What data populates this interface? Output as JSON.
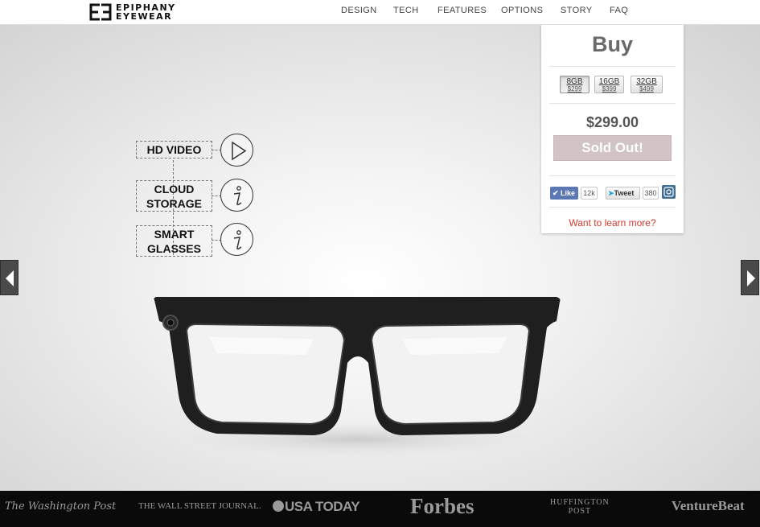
{
  "brand": {
    "line1": "EPIPHANY",
    "line2": "EYEWEAR",
    "logo_icon": "ee-logo-mark"
  },
  "nav": {
    "items": [
      "DESIGN",
      "TECH",
      "FEATURES",
      "OPTIONS",
      "STORY",
      "FAQ"
    ]
  },
  "features": [
    {
      "lines": [
        "HD VIDEO"
      ],
      "icon": "play-icon"
    },
    {
      "lines": [
        "CLOUD",
        "STORAGE"
      ],
      "icon": "info-icon"
    },
    {
      "lines": [
        "SMART",
        "GLASSES"
      ],
      "icon": "info-icon"
    }
  ],
  "buy": {
    "title": "Buy",
    "options": [
      {
        "capacity": "8GB",
        "price": "$299",
        "selected": true
      },
      {
        "capacity": "16GB",
        "price": "$399",
        "selected": false
      },
      {
        "capacity": "32GB",
        "price": "$499",
        "selected": false
      }
    ],
    "price": "$299.00",
    "button": "Sold Out!",
    "facebook": {
      "label": "Like",
      "count": "12k"
    },
    "twitter": {
      "label": "Tweet",
      "count": "380"
    },
    "learn_more": "Want to learn more?"
  },
  "press": {
    "washington_post": "The Washington Post",
    "wsj": "THE WALL STREET JOURNAL.",
    "usa_today": "USA TODAY",
    "forbes": "Forbes",
    "huffington_1": "HUFFINGTON",
    "huffington_2": "POST",
    "venturebeat": "VentureBeat"
  },
  "colors": {
    "accent": "#d03a2e",
    "sold_out_bg": "#d2c4c4",
    "facebook": "#5b78b3",
    "instagram": "#3f6f93",
    "footer_bg": "#0a0a0a"
  }
}
